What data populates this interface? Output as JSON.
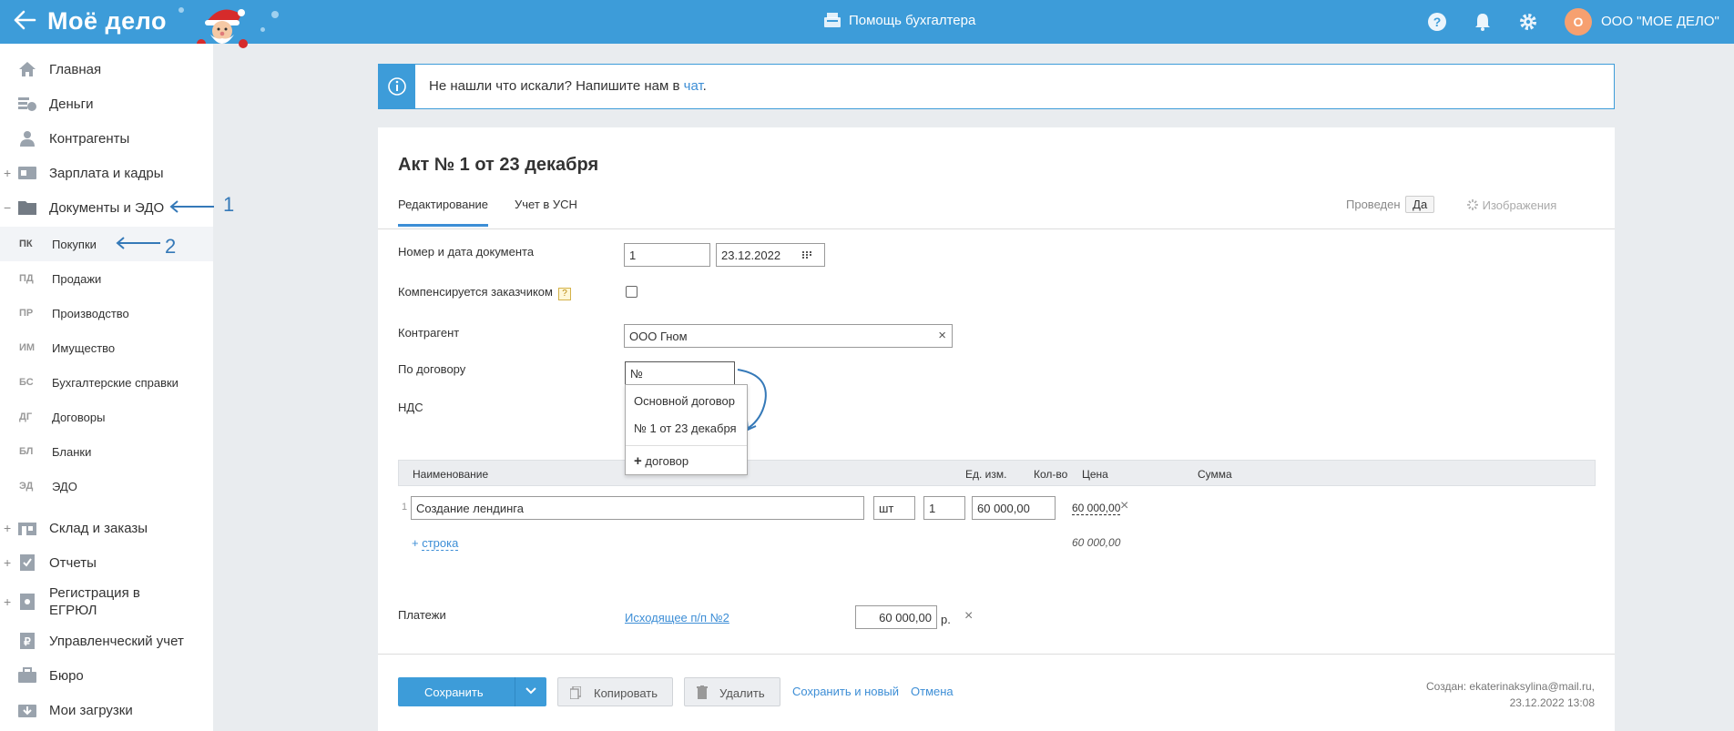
{
  "header": {
    "logo": "Моё дело",
    "helper_label": "Помощь бухгалтера",
    "company_avatar": "О",
    "company_name": "ООО \"МОЕ ДЕЛО\""
  },
  "sidebar": {
    "items": [
      {
        "label": "Главная",
        "icon": "home-icon"
      },
      {
        "label": "Деньги",
        "icon": "money-icon"
      },
      {
        "label": "Контрагенты",
        "icon": "contractors-icon"
      },
      {
        "label": "Зарплата и кадры",
        "icon": "salary-icon"
      },
      {
        "label": "Документы и ЭДО",
        "icon": "folder-icon"
      },
      {
        "label": "Склад и заказы",
        "icon": "warehouse-icon"
      },
      {
        "label": "Отчеты",
        "icon": "reports-icon"
      },
      {
        "label": "Регистрация в",
        "label2": "ЕГРЮЛ",
        "icon": "registration-icon"
      },
      {
        "label": "Управленческий учет",
        "icon": "management-icon"
      },
      {
        "label": "Бюро",
        "icon": "briefcase-icon"
      },
      {
        "label": "Мои загрузки",
        "icon": "downloads-icon"
      }
    ],
    "subitems": [
      {
        "abbr": "ПК",
        "label": "Покупки"
      },
      {
        "abbr": "ПД",
        "label": "Продажи"
      },
      {
        "abbr": "ПР",
        "label": "Производство"
      },
      {
        "abbr": "ИМ",
        "label": "Имущество"
      },
      {
        "abbr": "БС",
        "label": "Бухгалтерские справки"
      },
      {
        "abbr": "ДГ",
        "label": "Договоры"
      },
      {
        "abbr": "БЛ",
        "label": "Бланки"
      },
      {
        "abbr": "ЭД",
        "label": "ЭДО"
      }
    ],
    "annotations": [
      "1",
      "2"
    ]
  },
  "info": {
    "text": "Не нашли что искали? Напишите нам в ",
    "link": "чат",
    "end": "."
  },
  "document": {
    "title": "Акт № 1 от 23 декабря",
    "tabs": [
      "Редактирование",
      "Учет в УСН"
    ],
    "status_label": "Проведен",
    "status_value": "Да",
    "images_label": "Изображения",
    "fields": {
      "number_date_label": "Номер и дата документа",
      "number": "1",
      "date": "23.12.2022",
      "compensated_label": "Компенсируется заказчиком",
      "counterparty_label": "Контрагент",
      "counterparty": "ООО Гном",
      "contract_label": "По договору",
      "contract_placeholder": "№",
      "vat_label": "НДС"
    },
    "contract_dropdown": {
      "options": [
        "Основной договор",
        "№ 1 от 23 декабря"
      ],
      "add_label": "договор"
    },
    "table": {
      "columns": [
        "Наименование",
        "Ед. изм.",
        "Кол-во",
        "Цена",
        "Сумма"
      ],
      "rows": [
        {
          "num": "1",
          "name": "Создание лендинга",
          "unit": "шт",
          "qty": "1",
          "price": "60 000,00",
          "sum": "60 000,00"
        }
      ],
      "add_row": "строка",
      "total": "60 000,00"
    },
    "payments": {
      "label": "Платежи",
      "link": "Исходящее п/п №2",
      "amount": "60 000,00",
      "currency": "р."
    },
    "footer": {
      "save": "Сохранить",
      "copy": "Копировать",
      "delete": "Удалить",
      "save_new": "Сохранить и новый",
      "cancel": "Отмена",
      "created_line1": "Создан: ekaterinaksylina@mail.ru,",
      "created_line2": "23.12.2022 13:08"
    }
  },
  "colors": {
    "header_bg": "#3d9cd9",
    "link": "#3d8ed6",
    "annotation": "#3579b8"
  }
}
